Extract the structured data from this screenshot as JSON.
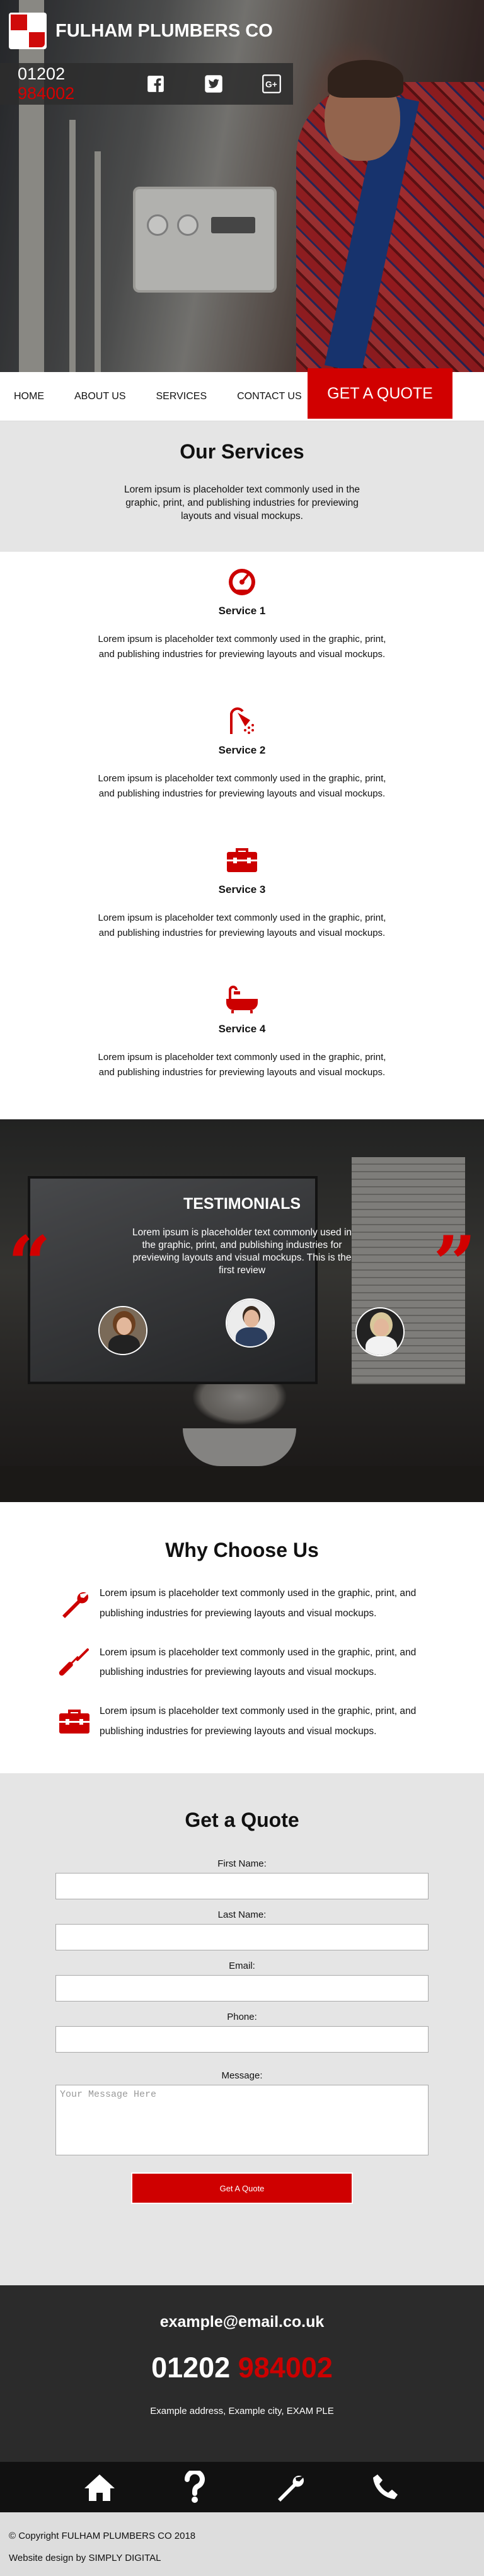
{
  "header": {
    "brand": "FULHAM PLUMBERS CO",
    "phone_prefix": "01202",
    "phone_suffix": "984002",
    "social": [
      "facebook-icon",
      "twitter-icon",
      "google-plus-icon"
    ]
  },
  "nav": {
    "items": [
      "HOME",
      "ABOUT US",
      "SERVICES",
      "CONTACT US"
    ],
    "quote_button": "GET A QUOTE"
  },
  "services": {
    "title": "Our Services",
    "intro": "Lorem ipsum is placeholder text commonly used in the graphic, print, and publishing industries for previewing layouts and visual mockups.",
    "items": [
      {
        "title": "Service 1",
        "text": "Lorem ipsum is placeholder text commonly used in the graphic, print, and publishing industries for previewing layouts and visual mockups.",
        "icon": "gauge-icon"
      },
      {
        "title": "Service 2",
        "text": "Lorem ipsum is placeholder text commonly used in the graphic, print, and publishing industries for previewing layouts and visual mockups.",
        "icon": "shower-icon"
      },
      {
        "title": "Service 3",
        "text": "Lorem ipsum is placeholder text commonly used in the graphic, print, and publishing industries for previewing layouts and visual mockups.",
        "icon": "toolbox-icon"
      },
      {
        "title": "Service 4",
        "text": "Lorem ipsum is placeholder text commonly used in the graphic, print, and publishing industries for previewing layouts and visual mockups.",
        "icon": "bathtub-icon"
      }
    ]
  },
  "testimonials": {
    "title": "TESTIMONIALS",
    "quote": "Lorem ipsum is placeholder text commonly used in the graphic, print, and publishing industries for previewing layouts and visual mockups. This is the first review"
  },
  "why": {
    "title": "Why Choose Us",
    "items": [
      {
        "text": "Lorem ipsum is placeholder text commonly used in the graphic, print, and publishing industries for previewing layouts and visual mockups.",
        "icon": "wrench-icon"
      },
      {
        "text": "Lorem ipsum is placeholder text commonly used in the graphic, print, and publishing industries for previewing layouts and visual mockups.",
        "icon": "screwdriver-icon"
      },
      {
        "text": "Lorem ipsum is placeholder text commonly used in the graphic, print, and publishing industries for previewing layouts and visual mockups.",
        "icon": "toolbox-icon"
      }
    ]
  },
  "quote_form": {
    "title": "Get a Quote",
    "first_name_label": "First Name:",
    "last_name_label": "Last Name:",
    "email_label": "Email:",
    "phone_label": "Phone:",
    "message_label": "Message:",
    "message_placeholder": "Your Message Here",
    "submit_label": "Get A Quote"
  },
  "contact": {
    "email": "example@email.co.uk",
    "phone_prefix": "01202",
    "phone_suffix": "984002",
    "address": "Example address, Example city, EXAM PLE"
  },
  "icon_bar": [
    "home-icon",
    "question-icon",
    "wrench-icon",
    "phone-icon"
  ],
  "footer": {
    "copyright": "© Copyright FULHAM PLUMBERS CO 2018",
    "credit": "Website design by SIMPLY DIGITAL"
  },
  "colors": {
    "accent": "#d10000",
    "dark": "#2b2b2b",
    "light_bg": "#e5e5e5"
  }
}
